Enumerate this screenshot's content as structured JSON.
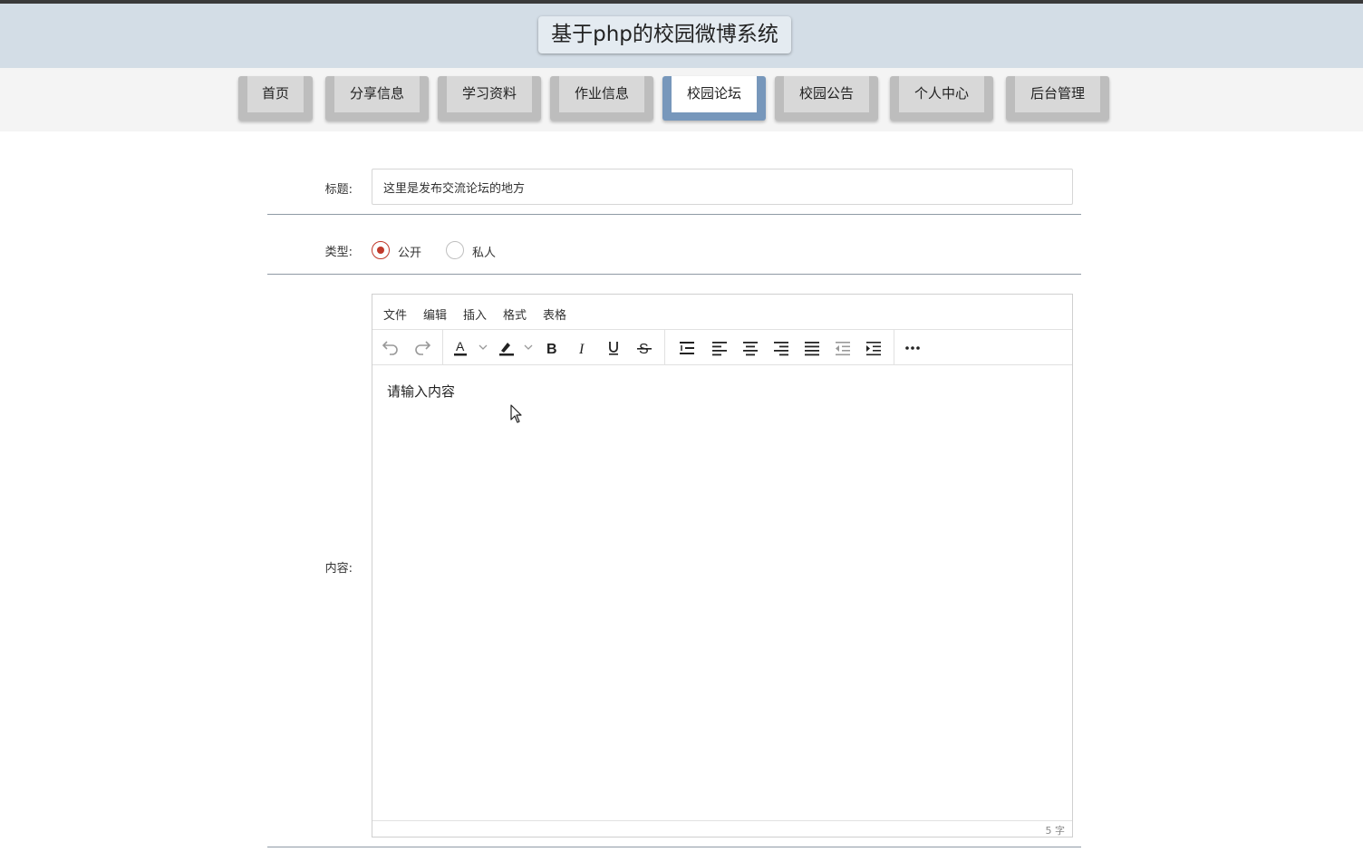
{
  "header": {
    "title": "基于php的校园微博系统"
  },
  "nav": {
    "items": [
      {
        "label": "首页"
      },
      {
        "label": "分享信息"
      },
      {
        "label": "学习资料"
      },
      {
        "label": "作业信息"
      },
      {
        "label": "校园论坛"
      },
      {
        "label": "校园公告"
      },
      {
        "label": "个人中心"
      },
      {
        "label": "后台管理"
      }
    ],
    "active_index": 4
  },
  "form": {
    "title_label": "标题:",
    "title_value": "这里是发布交流论坛的地方",
    "type_label": "类型:",
    "type_options": [
      {
        "label": "公开",
        "checked": true
      },
      {
        "label": "私人",
        "checked": false
      }
    ],
    "content_label": "内容:"
  },
  "editor": {
    "menu": [
      "文件",
      "编辑",
      "插入",
      "格式",
      "表格"
    ],
    "toolbar_icons": [
      "undo-icon",
      "redo-icon",
      "text-color-icon",
      "highlight-color-icon",
      "bold-icon",
      "italic-icon",
      "underline-icon",
      "strikethrough-icon",
      "line-height-icon",
      "align-left-icon",
      "align-center-icon",
      "align-right-icon",
      "align-justify-icon",
      "outdent-icon",
      "indent-icon",
      "more-icon"
    ],
    "placeholder": "请输入内容",
    "word_count": "5 字"
  },
  "colors": {
    "header_bg": "#d3dde6",
    "nav_active_border": "#7797bb",
    "radio_checked": "#c0392b"
  }
}
